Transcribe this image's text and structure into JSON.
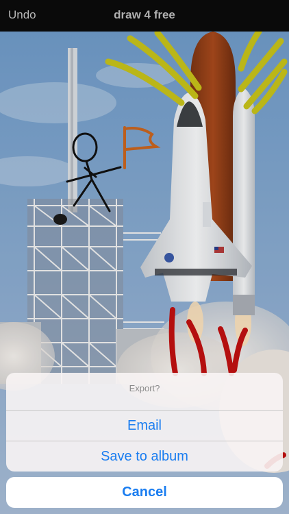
{
  "navbar": {
    "undo_label": "Undo",
    "title": "draw 4 free"
  },
  "canvas": {
    "photo_subject": "space shuttle launch",
    "drawing_colors": {
      "black": "#111111",
      "orange": "#c8641e",
      "yellow": "#c6c21a",
      "red": "#c01010"
    }
  },
  "action_sheet": {
    "title": "Export?",
    "options": [
      "Email",
      "Save to album"
    ],
    "cancel_label": "Cancel",
    "accent_color": "#1a7df0"
  }
}
